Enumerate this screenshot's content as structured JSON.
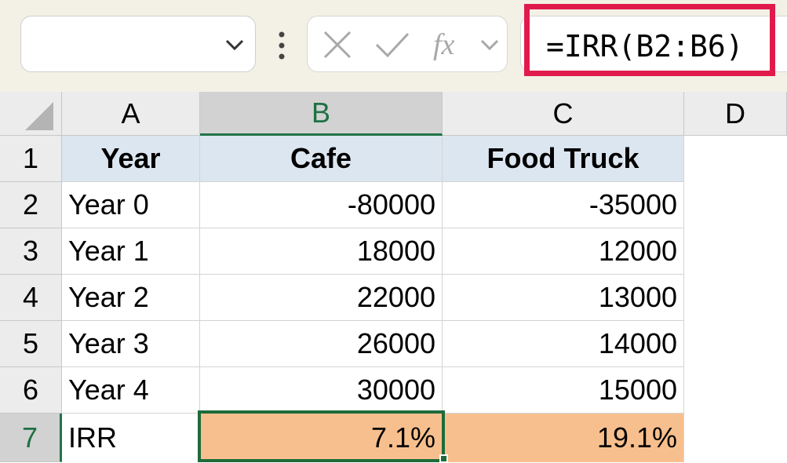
{
  "name_box": {
    "value": ""
  },
  "formula_bar": {
    "formula": "=IRR(B2:B6)",
    "highlight_color": "#e01b4c"
  },
  "icons": {
    "cancel": "cancel-x-icon",
    "enter": "checkmark-icon",
    "function": "fx-icon",
    "expand": "chevron-down-icon",
    "more": "vertical-ellipsis-icon"
  },
  "columns": [
    "A",
    "B",
    "C",
    "D"
  ],
  "rows": [
    "1",
    "2",
    "3",
    "4",
    "5",
    "6",
    "7"
  ],
  "selected_cell": {
    "column": "B",
    "row": "7"
  },
  "table": {
    "header": {
      "year": "Year",
      "cafe": "Cafe",
      "food_truck": "Food Truck"
    },
    "data_rows": [
      {
        "year": "Year 0",
        "cafe": "-80000",
        "food_truck": "-35000"
      },
      {
        "year": "Year 1",
        "cafe": "18000",
        "food_truck": "12000"
      },
      {
        "year": "Year 2",
        "cafe": "22000",
        "food_truck": "13000"
      },
      {
        "year": "Year 3",
        "cafe": "26000",
        "food_truck": "14000"
      },
      {
        "year": "Year 4",
        "cafe": "30000",
        "food_truck": "15000"
      }
    ],
    "irr_row": {
      "label": "IRR",
      "cafe": "7.1%",
      "food_truck": "19.1%"
    }
  },
  "colors": {
    "header_fill": "#dce6f0",
    "irr_fill": "#f8bf8e",
    "selection": "#1e6b3a"
  }
}
